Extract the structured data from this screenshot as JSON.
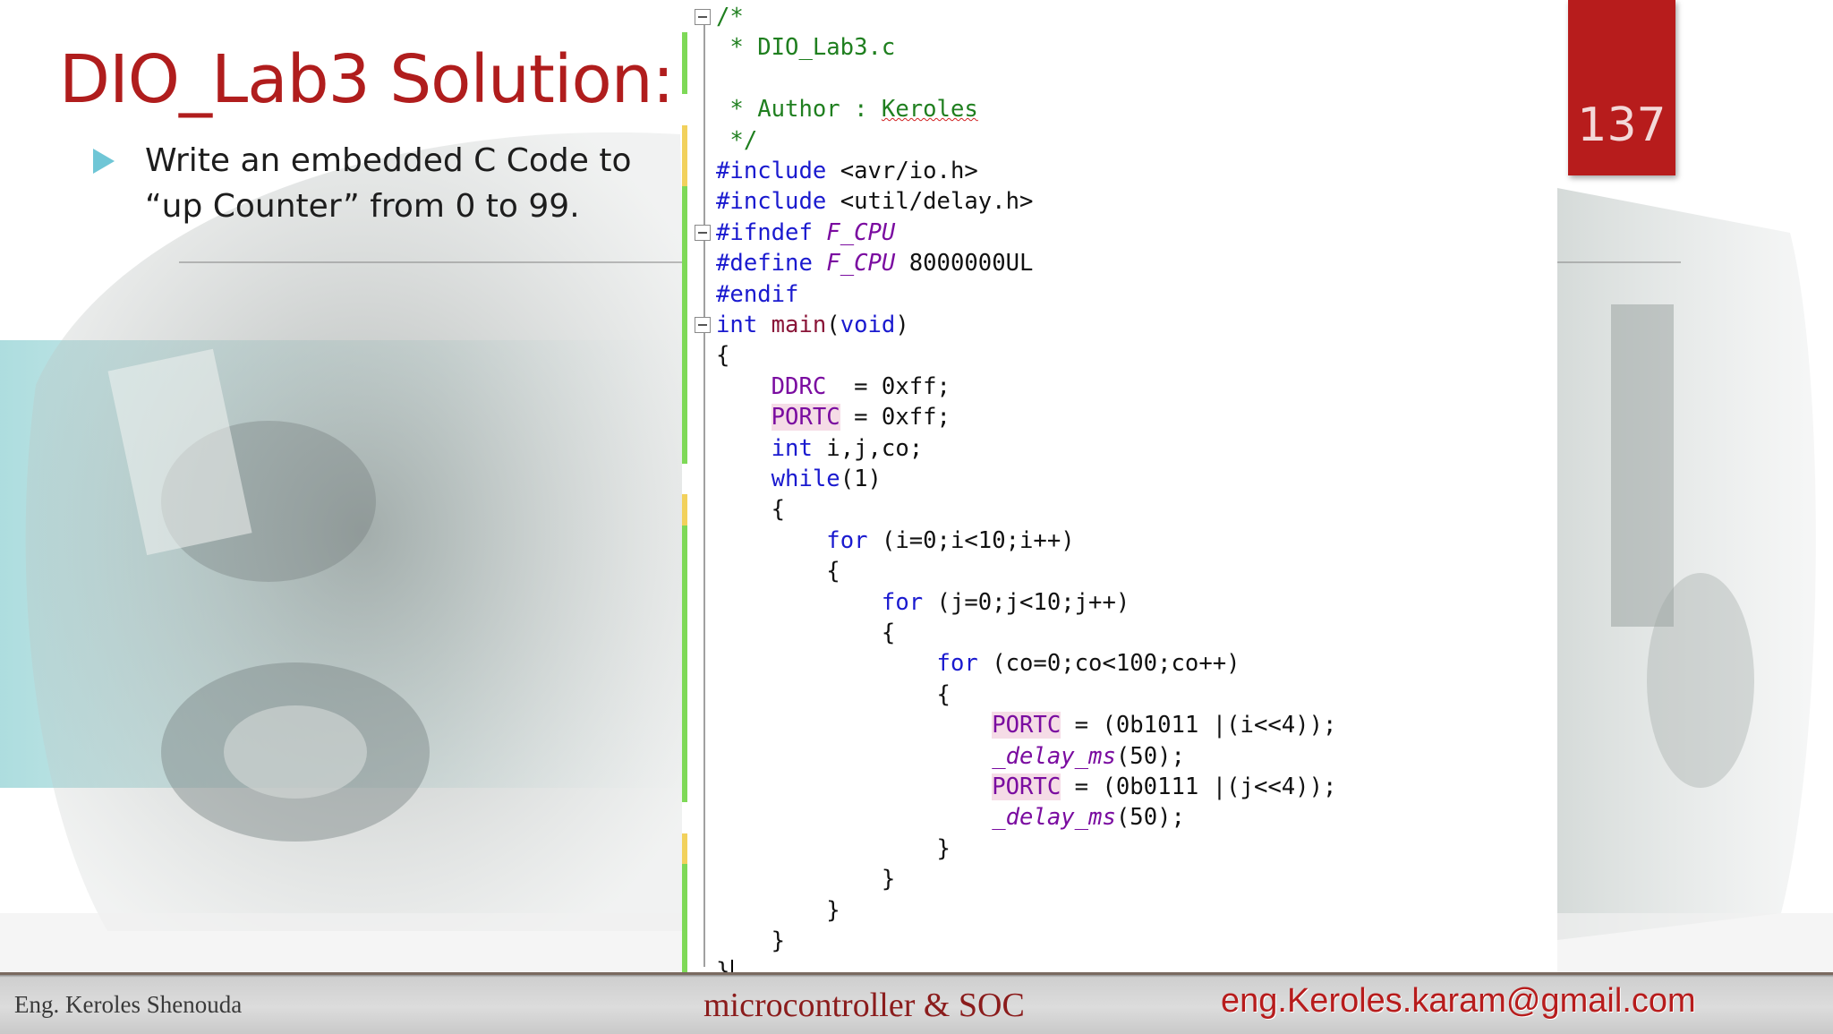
{
  "slide": {
    "title": "DIO_Lab3 Solution:",
    "bullet": "Write an embedded C Code to “up Counter” from 0 to 99.",
    "page_number": "137"
  },
  "editor": {
    "lines": [
      {
        "segs": [
          {
            "c": "com",
            "t": "/*"
          }
        ]
      },
      {
        "segs": [
          {
            "c": "com",
            "t": " * DIO_Lab3.c"
          }
        ]
      },
      {
        "segs": [
          {
            "c": "com",
            "t": " "
          }
        ]
      },
      {
        "segs": [
          {
            "c": "com",
            "t": " * Author : "
          },
          {
            "c": "com squig",
            "t": "Keroles"
          }
        ]
      },
      {
        "segs": [
          {
            "c": "com",
            "t": " */"
          }
        ]
      },
      {
        "segs": [
          {
            "c": "pre",
            "t": "#include "
          },
          {
            "c": "",
            "t": "<avr/io.h>"
          }
        ]
      },
      {
        "segs": [
          {
            "c": "pre",
            "t": "#include "
          },
          {
            "c": "",
            "t": "<util/delay.h>"
          }
        ]
      },
      {
        "segs": [
          {
            "c": "pre",
            "t": "#ifndef "
          },
          {
            "c": "mac",
            "t": "F_CPU"
          }
        ]
      },
      {
        "segs": [
          {
            "c": "pre",
            "t": "#define "
          },
          {
            "c": "mac",
            "t": "F_CPU"
          },
          {
            "c": "",
            "t": " 8000000UL"
          }
        ]
      },
      {
        "segs": [
          {
            "c": "pre",
            "t": "#endif"
          }
        ]
      },
      {
        "segs": [
          {
            "c": "kw",
            "t": "int "
          },
          {
            "c": "fn",
            "t": "main"
          },
          {
            "c": "",
            "t": "("
          },
          {
            "c": "kw",
            "t": "void"
          },
          {
            "c": "",
            "t": ")"
          }
        ]
      },
      {
        "segs": [
          {
            "c": "",
            "t": "{"
          }
        ]
      },
      {
        "segs": [
          {
            "c": "",
            "t": "    "
          },
          {
            "c": "reg",
            "t": "DDRC"
          },
          {
            "c": "",
            "t": "  = 0xff;"
          }
        ]
      },
      {
        "segs": [
          {
            "c": "",
            "t": "    "
          },
          {
            "c": "reg hl",
            "t": "PORTC"
          },
          {
            "c": "",
            "t": " = 0xff;"
          }
        ]
      },
      {
        "segs": [
          {
            "c": "",
            "t": "    "
          },
          {
            "c": "kw",
            "t": "int"
          },
          {
            "c": "",
            "t": " i,j,co;"
          }
        ]
      },
      {
        "segs": [
          {
            "c": "",
            "t": "    "
          },
          {
            "c": "kw",
            "t": "while"
          },
          {
            "c": "",
            "t": "(1)"
          }
        ]
      },
      {
        "segs": [
          {
            "c": "",
            "t": "    {"
          }
        ]
      },
      {
        "segs": [
          {
            "c": "",
            "t": "        "
          },
          {
            "c": "kw",
            "t": "for"
          },
          {
            "c": "",
            "t": " (i=0;i<10;i++)"
          }
        ]
      },
      {
        "segs": [
          {
            "c": "",
            "t": "        {"
          }
        ]
      },
      {
        "segs": [
          {
            "c": "",
            "t": "            "
          },
          {
            "c": "kw",
            "t": "for"
          },
          {
            "c": "",
            "t": " (j=0;j<10;j++)"
          }
        ]
      },
      {
        "segs": [
          {
            "c": "",
            "t": "            {"
          }
        ]
      },
      {
        "segs": [
          {
            "c": "",
            "t": "                "
          },
          {
            "c": "kw",
            "t": "for"
          },
          {
            "c": "",
            "t": " (co=0;co<100;co++)"
          }
        ]
      },
      {
        "segs": [
          {
            "c": "",
            "t": "                {"
          }
        ]
      },
      {
        "segs": [
          {
            "c": "",
            "t": "                    "
          },
          {
            "c": "reg hl",
            "t": "PORTC"
          },
          {
            "c": "",
            "t": " = (0b1011 |(i<<4));"
          }
        ]
      },
      {
        "segs": [
          {
            "c": "",
            "t": "                    "
          },
          {
            "c": "mac",
            "t": "_delay_ms"
          },
          {
            "c": "",
            "t": "(50);"
          }
        ]
      },
      {
        "segs": [
          {
            "c": "",
            "t": "                    "
          },
          {
            "c": "reg hl",
            "t": "PORTC"
          },
          {
            "c": "",
            "t": " = (0b0111 |(j<<4));"
          }
        ]
      },
      {
        "segs": [
          {
            "c": "",
            "t": "                    "
          },
          {
            "c": "mac",
            "t": "_delay_ms"
          },
          {
            "c": "",
            "t": "(50);"
          }
        ]
      },
      {
        "segs": [
          {
            "c": "",
            "t": "                }"
          }
        ]
      },
      {
        "segs": [
          {
            "c": "",
            "t": "            }"
          }
        ]
      },
      {
        "segs": [
          {
            "c": "",
            "t": "        }"
          }
        ]
      },
      {
        "segs": [
          {
            "c": "",
            "t": "    }"
          }
        ]
      },
      {
        "segs": [
          {
            "c": "",
            "t": "}"
          }
        ],
        "cursor": true
      }
    ],
    "fold_markers": [
      0,
      7,
      10
    ],
    "change_bars": [
      {
        "from": 1,
        "to": 3,
        "color": "#7ed957"
      },
      {
        "from": 4,
        "to": 6,
        "color": "#f2d15c"
      },
      {
        "from": 6,
        "to": 15,
        "color": "#7ed957"
      },
      {
        "from": 16,
        "to": 17,
        "color": "#f2d15c"
      },
      {
        "from": 17,
        "to": 26,
        "color": "#7ed957"
      },
      {
        "from": 27,
        "to": 28,
        "color": "#f2d15c"
      },
      {
        "from": 28,
        "to": 32,
        "color": "#7ed957"
      }
    ]
  },
  "footer": {
    "author": "Eng. Keroles Shenouda",
    "course": "microcontroller & SOC",
    "email": "eng.Keroles.karam@gmail.com"
  },
  "colors": {
    "title": "#b01d1d",
    "badge": "#b71c1c",
    "bullet_icon": "#6fc6d6"
  }
}
